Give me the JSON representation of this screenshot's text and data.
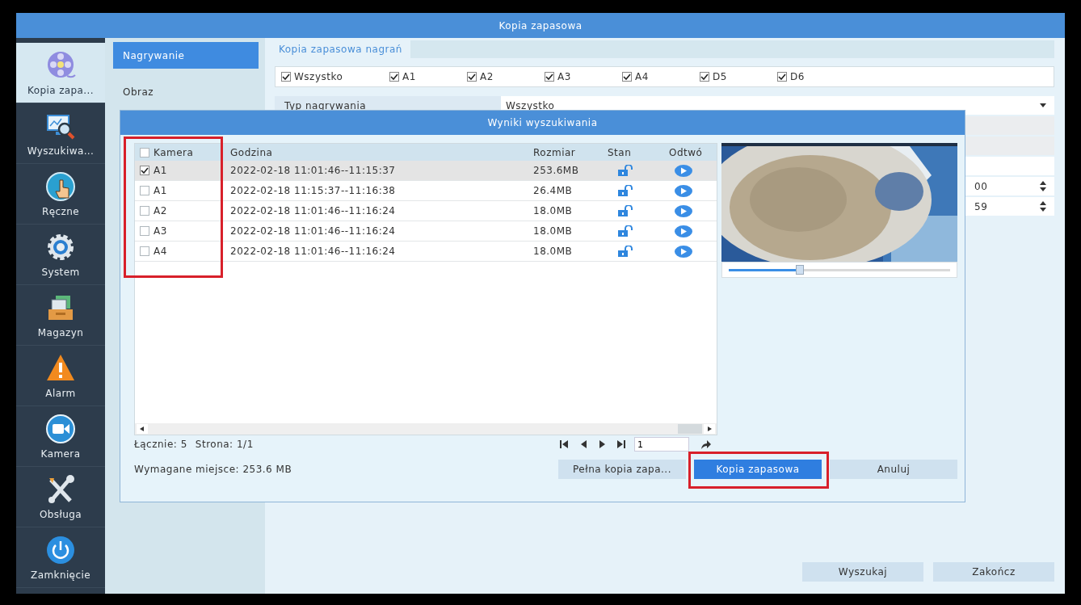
{
  "window": {
    "title": "Kopia zapasowa"
  },
  "nav": {
    "items": [
      {
        "label": "Kopia zapa...",
        "selected": true
      },
      {
        "label": "Wyszukiwa...",
        "selected": false
      },
      {
        "label": "Ręczne",
        "selected": false
      },
      {
        "label": "System",
        "selected": false
      },
      {
        "label": "Magazyn",
        "selected": false
      },
      {
        "label": "Alarm",
        "selected": false
      },
      {
        "label": "Kamera",
        "selected": false
      },
      {
        "label": "Obsługa",
        "selected": false
      },
      {
        "label": "Zamknięcie",
        "selected": false
      }
    ]
  },
  "subnav": {
    "items": [
      {
        "label": "Nagrywanie",
        "selected": true
      },
      {
        "label": "Obraz",
        "selected": false
      }
    ]
  },
  "tabs": [
    {
      "label": "Kopia zapasowa nagrań",
      "selected": true
    }
  ],
  "channels": [
    {
      "label": "Wszystko",
      "checked": true
    },
    {
      "label": "A1",
      "checked": true
    },
    {
      "label": "A2",
      "checked": true
    },
    {
      "label": "A3",
      "checked": true
    },
    {
      "label": "A4",
      "checked": true
    },
    {
      "label": "D5",
      "checked": true
    },
    {
      "label": "D6",
      "checked": true
    }
  ],
  "form": {
    "rows": [
      {
        "kind": "select",
        "label": "Typ nagrywania",
        "value": "Wszystko",
        "disabled": false
      },
      {
        "kind": "select",
        "disabled": true
      },
      {
        "kind": "select",
        "disabled": true
      },
      {
        "kind": "select",
        "disabled": false
      },
      {
        "kind": "spinner",
        "value": "00"
      },
      {
        "kind": "spinner",
        "value": "59"
      }
    ]
  },
  "buttons": [
    {
      "label": "Wyszukaj"
    },
    {
      "label": "Zakończ"
    }
  ],
  "dialog": {
    "title": "Wyniki wyszukiwania",
    "table": {
      "columns": [
        {
          "label": "Kamera",
          "checked": false,
          "highlighted": true
        },
        {
          "label": "Godzina",
          "highlighted": false
        },
        {
          "label": "Rozmiar",
          "highlighted": false
        },
        {
          "label": "Stan",
          "highlighted": false
        },
        {
          "label": "Odtwó",
          "highlighted": false
        }
      ],
      "rows": [
        {
          "camera": "A1",
          "time": "2022-02-18 11:01:46--11:15:37",
          "size": "253.6MB",
          "locked": false,
          "checked": true,
          "selected": true
        },
        {
          "camera": "A1",
          "time": "2022-02-18 11:15:37--11:16:38",
          "size": "26.4MB",
          "locked": false,
          "checked": false,
          "selected": false
        },
        {
          "camera": "A2",
          "time": "2022-02-18 11:01:46--11:16:24",
          "size": "18.0MB",
          "locked": false,
          "checked": false,
          "selected": false
        },
        {
          "camera": "A3",
          "time": "2022-02-18 11:01:46--11:16:24",
          "size": "18.0MB",
          "locked": false,
          "checked": false,
          "selected": false
        },
        {
          "camera": "A4",
          "time": "2022-02-18 11:01:46--11:16:24",
          "size": "18.0MB",
          "locked": false,
          "checked": false,
          "selected": false
        }
      ]
    },
    "preview": {
      "kind": "picture",
      "level": 0.32
    },
    "total": "Łącznie: 5",
    "page_info": "Strona: 1/1",
    "pager": {
      "page": "1"
    },
    "required_space": "Wymagane miejsce: 253.6 MB",
    "buttons": [
      {
        "label": "Pełna kopia zapa...",
        "primary": false,
        "highlighted": false
      },
      {
        "label": "Kopia zapasowa",
        "primary": true,
        "highlighted": true
      },
      {
        "label": "Anuluj",
        "primary": false,
        "highlighted": false
      }
    ]
  }
}
